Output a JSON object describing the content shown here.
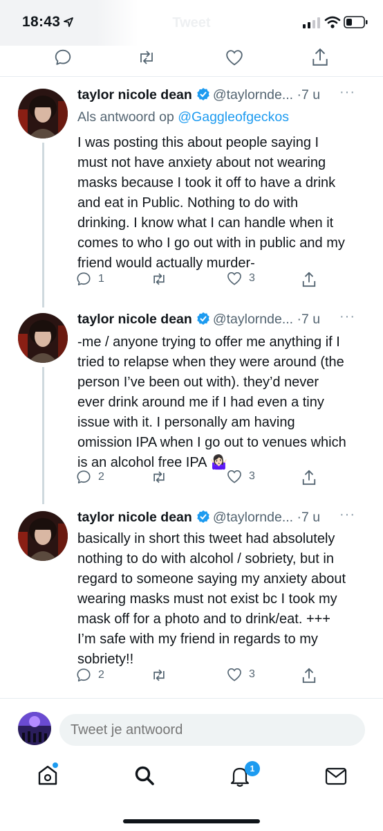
{
  "status_bar": {
    "time": "18:43"
  },
  "header": {
    "title": "Tweet"
  },
  "tweets": [
    {
      "name": "taylor nicole dean",
      "handle": "@taylornde...",
      "dot": "·",
      "time": "7 u",
      "more": "···",
      "reply_to_prefix": "Als antwoord op",
      "reply_to_user": "@Gaggleofgeckos",
      "text_lines": [
        "I was posting this about people saying I",
        "must not have anxiety about not wearing",
        "masks because I took it off to have a drink",
        "and eat in Public. Nothing to do with",
        "drinking. I know what I can handle when it",
        "comes to who I go out with in public and my",
        "friend would actually murder-"
      ],
      "replies": "1",
      "retweets": "",
      "likes": "3"
    },
    {
      "name": "taylor nicole dean",
      "handle": "@taylornde...",
      "dot": "·",
      "time": "7 u",
      "more": "···",
      "text_lines": [
        "-me / anyone trying to offer me anything if I",
        "tried to relapse when they were around (the",
        "person I’ve been out with). they’d never",
        "ever drink around me if I had even a tiny",
        "issue with it. I personally am having",
        "omission IPA when I go out to venues which",
        "is an alcohol free IPA 🤷🏻‍♀️"
      ],
      "replies": "2",
      "retweets": "",
      "likes": "3"
    },
    {
      "name": "taylor nicole dean",
      "handle": "@taylornde...",
      "dot": "·",
      "time": "7 u",
      "more": "···",
      "text_lines": [
        "basically in short this tweet had absolutely",
        "nothing to do with alcohol / sobriety, but in",
        "regard to someone saying my anxiety about",
        "wearing masks must not exist bc I took my",
        "mask off for a photo and to drink/eat. +++",
        "I’m safe with my friend in regards to my",
        "sobriety!!"
      ],
      "replies": "2",
      "retweets": "",
      "likes": "3"
    }
  ],
  "composer": {
    "placeholder": "Tweet je antwoord"
  },
  "bottom_nav": {
    "items": [
      "home-icon",
      "search-icon",
      "notifications-icon",
      "messages-icon"
    ],
    "notifications_badge": "1"
  },
  "colors": {
    "accent": "#1d9bf0",
    "text": "#0f1419",
    "secondary": "#536471"
  }
}
